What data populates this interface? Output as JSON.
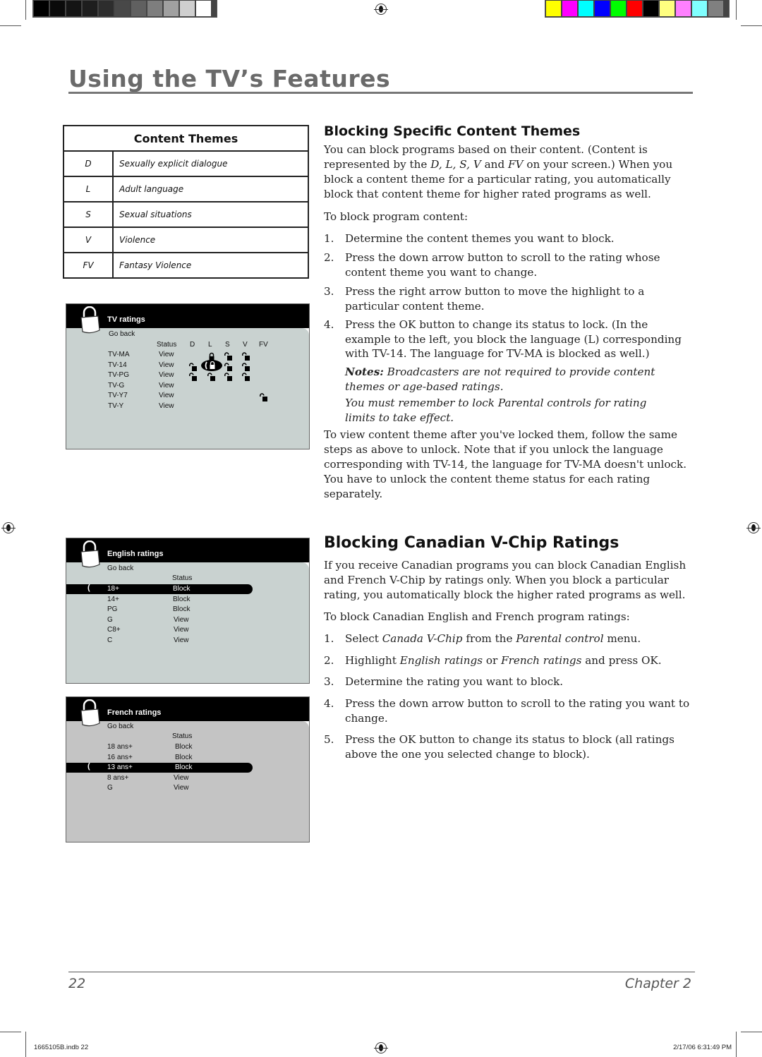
{
  "print_marks": {
    "grayscale_swatches": [
      "#000000",
      "#0a0a0a",
      "#141414",
      "#1e1e1e",
      "#2d2d2d",
      "#484848",
      "#606060",
      "#7e7e7e",
      "#a0a0a0",
      "#cfcfcf",
      "#ffffff"
    ],
    "color_swatches": [
      "#ffff00",
      "#ff00ff",
      "#00ffff",
      "#0000ff",
      "#00ff00",
      "#ff0000",
      "#000000",
      "#ffff80",
      "#ff80ff",
      "#80ffff",
      "#808080"
    ]
  },
  "header": {
    "title": "Using the TV’s Features"
  },
  "content_themes_table": {
    "heading": "Content Themes",
    "rows": [
      {
        "code": "D",
        "description": "Sexually explicit dialogue"
      },
      {
        "code": "L",
        "description": "Adult language"
      },
      {
        "code": "S",
        "description": "Sexual situations"
      },
      {
        "code": "V",
        "description": "Violence"
      },
      {
        "code": "FV",
        "description": "Fantasy Violence"
      }
    ]
  },
  "tv_ratings_menu": {
    "title": "TV ratings",
    "go_back": "Go back",
    "columns": [
      "Status",
      "D",
      "L",
      "S",
      "V",
      "FV"
    ],
    "rows": [
      {
        "rating": "TV-MA",
        "status": "View",
        "D": "",
        "L": "locked",
        "S": "unlocked",
        "V": "unlocked",
        "FV": ""
      },
      {
        "rating": "TV-14",
        "status": "View",
        "D": "unlocked",
        "L": "locked-selected",
        "S": "unlocked",
        "V": "unlocked",
        "FV": ""
      },
      {
        "rating": "TV-PG",
        "status": "View",
        "D": "unlocked",
        "L": "unlocked",
        "S": "unlocked",
        "V": "unlocked",
        "FV": ""
      },
      {
        "rating": "TV-G",
        "status": "View",
        "D": "",
        "L": "",
        "S": "",
        "V": "",
        "FV": ""
      },
      {
        "rating": "TV-Y7",
        "status": "View",
        "D": "",
        "L": "",
        "S": "",
        "V": "",
        "FV": "unlocked"
      },
      {
        "rating": "TV-Y",
        "status": "View",
        "D": "",
        "L": "",
        "S": "",
        "V": "",
        "FV": ""
      }
    ]
  },
  "english_ratings_menu": {
    "title": "English ratings",
    "go_back": "Go back",
    "status_header": "Status",
    "selected_index": 0,
    "rows": [
      {
        "rating": "18+",
        "status": "Block"
      },
      {
        "rating": "14+",
        "status": "Block"
      },
      {
        "rating": "PG",
        "status": "Block"
      },
      {
        "rating": "G",
        "status": "View"
      },
      {
        "rating": "C8+",
        "status": "View"
      },
      {
        "rating": "C",
        "status": "View"
      }
    ]
  },
  "french_ratings_menu": {
    "title": "French ratings",
    "go_back": "Go back",
    "status_header": "Status",
    "selected_index": 2,
    "rows": [
      {
        "rating": "18 ans+",
        "status": "Block"
      },
      {
        "rating": "16 ans+",
        "status": "Block"
      },
      {
        "rating": "13 ans+",
        "status": "Block"
      },
      {
        "rating": "8 ans+",
        "status": "View"
      },
      {
        "rating": "G",
        "status": "View"
      }
    ]
  },
  "section1": {
    "heading": "Blocking Specific Content Themes",
    "intro_a": "You can block programs based on their content. (Content is represented by the ",
    "intro_codes": "D, L, S, V",
    "intro_and": " and ",
    "intro_fv": "FV",
    "intro_b": " on your screen.) When you block a content theme for a particular rating, you automatically block that content theme for higher rated programs as well.",
    "lead": "To block program content:",
    "steps": [
      {
        "num": "1.",
        "text": "Determine the content themes you want to block."
      },
      {
        "num": "2.",
        "text": "Press the down arrow button to scroll to the rating whose content theme you want to change."
      },
      {
        "num": "3.",
        "text": "Press the right arrow button to move the highlight to a particular content theme."
      },
      {
        "num": "4.",
        "text": "Press the OK button to change its status to lock. (In the example to the left, you block the language (L) corresponding with TV-14. The language for TV-MA is blocked as well.)"
      }
    ],
    "notes_label": "Notes:",
    "note1": " Broadcasters are not required to provide content themes or age-based ratings.",
    "note2": "You must remember to lock Parental controls for rating limits to take effect.",
    "outro": "To view content theme after you've locked them, follow the same steps as above to unlock. Note that if you unlock the language corresponding with TV-14, the language for TV-MA doesn't unlock. You have to unlock the content theme status for each rating separately."
  },
  "section2": {
    "heading": "Blocking Canadian V-Chip Ratings",
    "intro": "If you receive Canadian programs you can block Canadian English and French V-Chip by ratings only. When you block a particular rating, you automatically block the higher rated programs as well.",
    "lead": "To block Canadian English and French program ratings:",
    "step1": {
      "num": "1.",
      "a": "Select ",
      "i1": "Canada V-Chip",
      "b": " from the ",
      "i2": "Parental control",
      "c": " menu."
    },
    "step2": {
      "num": "2.",
      "a": "Highlight ",
      "i1": "English ratings",
      "b": " or ",
      "i2": "French ratings",
      "c": " and press OK."
    },
    "steps": [
      {
        "num": "3.",
        "text": "Determine the rating you want to block."
      },
      {
        "num": "4.",
        "text": "Press the down arrow button to scroll to the rating you want to change."
      },
      {
        "num": "5.",
        "text": "Press the OK button to change its status to block (all ratings above the one you selected change to block)."
      }
    ]
  },
  "footer": {
    "page_number": "22",
    "chapter": "Chapter 2",
    "slug_file": "1665105B.indb   22",
    "slug_date": "2/17/06   6:31:49 PM"
  }
}
